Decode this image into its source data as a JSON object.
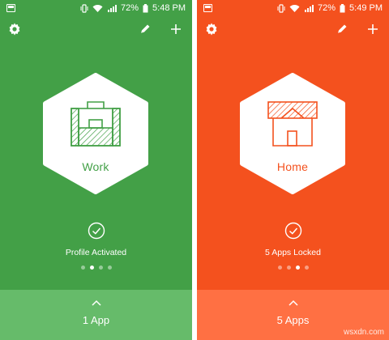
{
  "screens": [
    {
      "id": "work",
      "status": {
        "battery": "72%",
        "time": "5:48 PM"
      },
      "profile": {
        "name": "Work",
        "icon": "briefcase-icon"
      },
      "status_text": "Profile Activated",
      "pager": {
        "count": 4,
        "active": 2
      },
      "bottom": {
        "label": "1 App"
      },
      "colors": {
        "bg": "#43a047",
        "panel": "#66bb6a",
        "accent": "#43a047"
      }
    },
    {
      "id": "home",
      "status": {
        "battery": "72%",
        "time": "5:49 PM"
      },
      "profile": {
        "name": "Home",
        "icon": "house-icon"
      },
      "status_text": "5 Apps Locked",
      "pager": {
        "count": 4,
        "active": 3
      },
      "bottom": {
        "label": "5 Apps"
      },
      "colors": {
        "bg": "#f4511e",
        "panel": "#ff7043",
        "accent": "#f4511e"
      }
    }
  ],
  "watermark": "wsxdn.com"
}
